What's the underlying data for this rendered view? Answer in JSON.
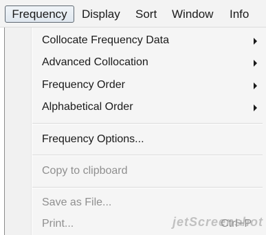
{
  "menubar": {
    "items": [
      {
        "label": "Frequency",
        "active": true
      },
      {
        "label": "Display"
      },
      {
        "label": "Sort"
      },
      {
        "label": "Window"
      },
      {
        "label": "Info"
      }
    ]
  },
  "dropdown": {
    "items": [
      {
        "label": "Collocate Frequency Data",
        "submenu": true,
        "enabled": true
      },
      {
        "label": "Advanced Collocation",
        "submenu": true,
        "enabled": true
      },
      {
        "label": "Frequency Order",
        "submenu": true,
        "enabled": true
      },
      {
        "label": "Alphabetical Order",
        "submenu": true,
        "enabled": true
      },
      {
        "label": "Frequency Options...",
        "enabled": true
      },
      {
        "label": "Copy to clipboard",
        "enabled": false
      },
      {
        "label": "Save as File...",
        "enabled": false
      },
      {
        "label": "Print...",
        "enabled": false,
        "shortcut": "Ctrl+P"
      }
    ]
  },
  "watermark": "jetScreenshot",
  "colors": {
    "menubar_bg": "#f3f3f3",
    "dropdown_bg": "#f5f5f5",
    "active_border": "#5d6770",
    "disabled_text": "#8f8f8f"
  }
}
